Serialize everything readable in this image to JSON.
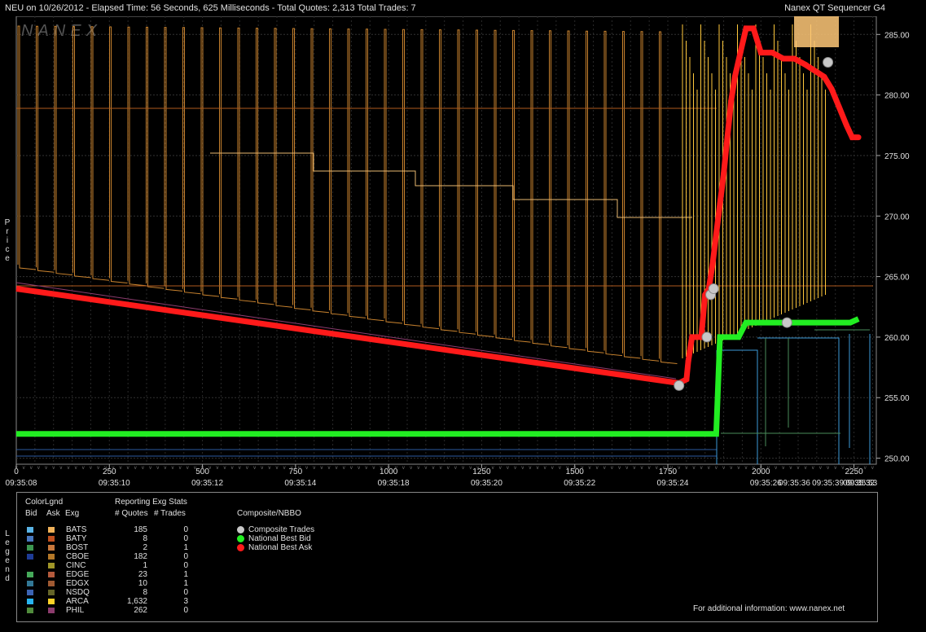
{
  "header": {
    "left": "NEU on 10/26/2012  -  Elapsed Time: 56 Seconds, 625 Milliseconds  -  Total Quotes: 2,313  Total Trades: 7",
    "right": "Nanex QT Sequencer G4"
  },
  "watermark": "NANEX",
  "side_labels": {
    "price": "Price",
    "legend": "Legend"
  },
  "chart_data": {
    "type": "line",
    "title": "",
    "ylabel": "Price",
    "ylim": [
      249.5,
      286.5
    ],
    "xlim": [
      0,
      2310
    ],
    "y_ticks": [
      "250.00",
      "255.00",
      "260.00",
      "265.00",
      "270.00",
      "275.00",
      "280.00",
      "285.00"
    ],
    "y_tick_values": [
      250,
      255,
      260,
      265,
      270,
      275,
      280,
      285
    ],
    "x_ticks": [
      {
        "seq": 0,
        "label": "0",
        "time": "09:35:08"
      },
      {
        "seq": 250,
        "label": "250",
        "time": "09:35:10"
      },
      {
        "seq": 500,
        "label": "500",
        "time": "09:35:12"
      },
      {
        "seq": 750,
        "label": "750",
        "time": "09:35:14"
      },
      {
        "seq": 1000,
        "label": "1000",
        "time": "09:35:18"
      },
      {
        "seq": 1250,
        "label": "1250",
        "time": "09:35:20"
      },
      {
        "seq": 1500,
        "label": "1500",
        "time": "09:35:22"
      },
      {
        "seq": 1750,
        "label": "1750",
        "time": "09:35:24"
      },
      {
        "seq": 2000,
        "label": "2000",
        "time": "09:35:26"
      },
      {
        "seq": 2250,
        "label": "2250",
        "time": "09:35:32"
      }
    ],
    "x_extra_times": [
      {
        "seq": 2090,
        "time": "09:35:36"
      },
      {
        "seq": 2180,
        "time": "09:35:39"
      },
      {
        "seq": 2270,
        "time": "09:35:53"
      }
    ],
    "series": [
      {
        "name": "National Best Ask",
        "color": "#ff1a1a",
        "x": [
          0,
          1780,
          1800,
          1805,
          1815,
          1825,
          1840,
          1850,
          1860,
          1870,
          1880,
          1890,
          1900,
          1910,
          1920,
          1930,
          1945,
          1960,
          1980,
          2000,
          2030,
          2060,
          2090,
          2120,
          2170,
          2190,
          2210,
          2230,
          2245,
          2255,
          2262
        ],
        "y": [
          264.0,
          256.2,
          256.5,
          258.0,
          260.0,
          260.0,
          260.0,
          263.5,
          264.0,
          266.0,
          268.5,
          271.0,
          273.5,
          276.5,
          279.5,
          281.5,
          283.5,
          285.5,
          285.5,
          283.5,
          283.5,
          283.0,
          283.0,
          282.5,
          281.5,
          280.5,
          279.0,
          277.5,
          276.5,
          276.5,
          276.5
        ]
      },
      {
        "name": "National Best Bid",
        "color": "#22ee22",
        "x": [
          0,
          1880,
          1890,
          1910,
          1940,
          1960,
          2000,
          2050,
          2100,
          2150,
          2200,
          2240,
          2262
        ],
        "y": [
          252.0,
          252.0,
          260.0,
          260.0,
          260.0,
          261.2,
          261.2,
          261.2,
          261.2,
          261.2,
          261.2,
          261.2,
          261.5
        ]
      },
      {
        "name": "Composite Trades",
        "color": "#c8c8c8",
        "x": [
          1780,
          1855,
          1865,
          1873,
          2070,
          2180
        ],
        "y": [
          256.0,
          260.0,
          263.5,
          264.0,
          261.2,
          282.7
        ]
      }
    ]
  },
  "legend": {
    "header_colorlgnd": "ColorLgnd",
    "header_bid": "Bid",
    "header_ask": "Ask",
    "header_exg": "Exg",
    "header_reporting": "Reporting Exg Stats",
    "header_quotes": "# Quotes",
    "header_trades": "# Trades",
    "header_composite": "Composite/NBBO",
    "rows": [
      {
        "exg": "BATS",
        "quotes": "185",
        "trades": "0",
        "bid": "#5ab4e6",
        "ask": "#f0b25a"
      },
      {
        "exg": "BATY",
        "quotes": "8",
        "trades": "0",
        "bid": "#4878c0",
        "ask": "#c0501e"
      },
      {
        "exg": "BOST",
        "quotes": "2",
        "trades": "1",
        "bid": "#3c9650",
        "ask": "#c8783c"
      },
      {
        "exg": "CBOE",
        "quotes": "182",
        "trades": "0",
        "bid": "#1e3c96",
        "ask": "#b47828"
      },
      {
        "exg": "CINC",
        "quotes": "1",
        "trades": "0",
        "bid": "#000000",
        "ask": "#a09628"
      },
      {
        "exg": "EDGE",
        "quotes": "23",
        "trades": "1",
        "bid": "#46aa5a",
        "ask": "#b45a3c"
      },
      {
        "exg": "EDGX",
        "quotes": "10",
        "trades": "1",
        "bid": "#327896",
        "ask": "#a05a32"
      },
      {
        "exg": "NSDQ",
        "quotes": "8",
        "trades": "0",
        "bid": "#3c64b4",
        "ask": "#646428"
      },
      {
        "exg": "ARCA",
        "quotes": "1,632",
        "trades": "3",
        "bid": "#28b4f0",
        "ask": "#ffd228"
      },
      {
        "exg": "PHIL",
        "quotes": "262",
        "trades": "0",
        "bid": "#508c3c",
        "ask": "#8c3c6e"
      }
    ],
    "nbbo": [
      {
        "label": "Composite Trades",
        "color": "#c8c8c8"
      },
      {
        "label": "National Best Bid",
        "color": "#22ee22"
      },
      {
        "label": "National Best Ask",
        "color": "#ff1a1a"
      }
    ],
    "footer": "For additional information: www.nanex.net"
  }
}
